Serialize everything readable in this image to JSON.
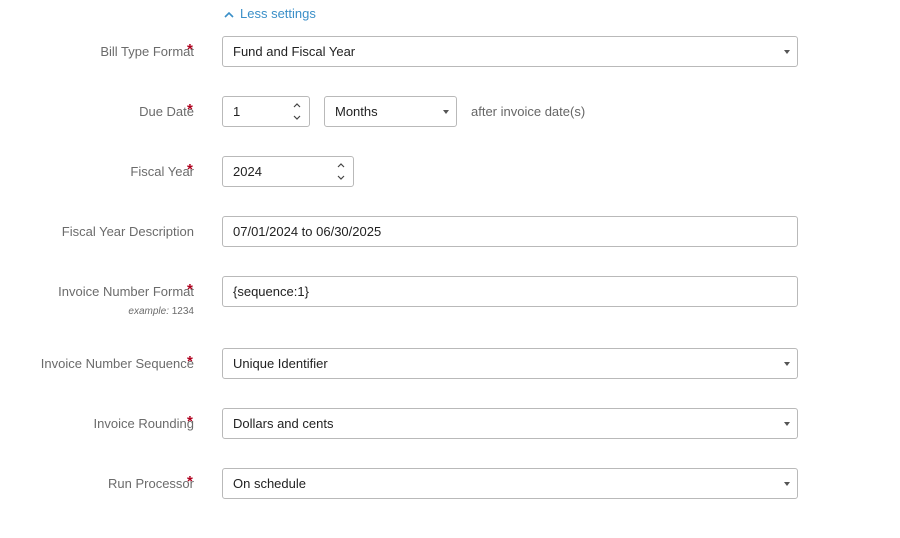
{
  "toggle": {
    "label": "Less settings",
    "icon": "chevron-up-icon"
  },
  "required_marker": "*",
  "fields": {
    "bill_type_format": {
      "label": "Bill Type Format",
      "value": "Fund and Fiscal Year"
    },
    "due_date": {
      "label": "Due Date",
      "value": "1",
      "unit": "Months",
      "suffix": "after invoice date(s)"
    },
    "fiscal_year": {
      "label": "Fiscal Year",
      "value": "2024"
    },
    "fiscal_year_description": {
      "label": "Fiscal Year Description",
      "value": "07/01/2024 to 06/30/2025"
    },
    "invoice_number_format": {
      "label": "Invoice Number Format",
      "value": "{sequence:1}",
      "example_label": "example:",
      "example_value": "1234"
    },
    "invoice_number_sequence": {
      "label": "Invoice Number Sequence",
      "value": "Unique Identifier"
    },
    "invoice_rounding": {
      "label": "Invoice Rounding",
      "value": "Dollars and cents"
    },
    "run_processor": {
      "label": "Run Processor",
      "value": "On schedule"
    }
  },
  "colors": {
    "link": "#3a8fc8",
    "required": "#b0001e",
    "label": "#6b6b6b",
    "border": "#b9b9b9"
  }
}
